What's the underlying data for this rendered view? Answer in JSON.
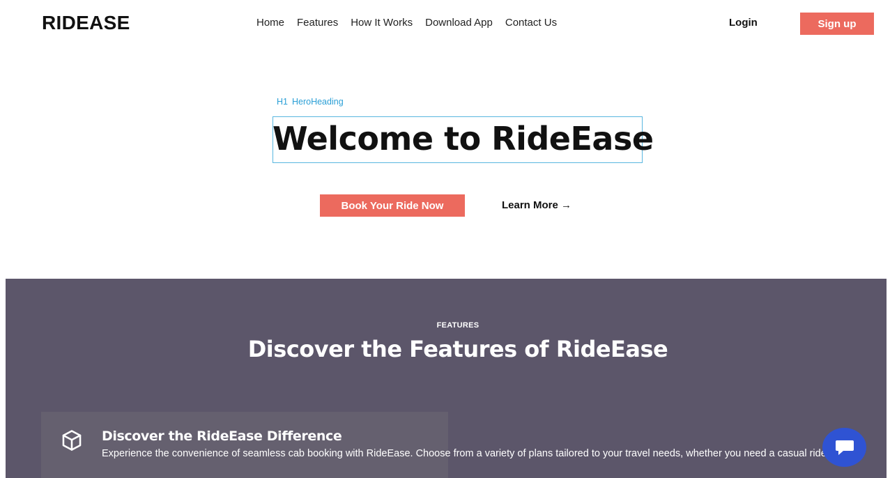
{
  "header": {
    "logo": "RIDEASE",
    "nav": [
      "Home",
      "Features",
      "How It Works",
      "Download App",
      "Contact Us"
    ],
    "login_label": "Login",
    "signup_label": "Sign up"
  },
  "hero": {
    "tag_type": "H1",
    "tag_name": "HeroHeading",
    "title": "Welcome to RideEase",
    "book_label": "Book Your Ride Now",
    "learn_label": "Learn More →"
  },
  "features": {
    "eyebrow": "FEATURES",
    "title": "Discover the Features of RideEase",
    "card": {
      "icon": "cube-icon",
      "title": "Discover the RideEase Difference",
      "text": "Experience the convenience of seamless cab booking with RideEase. Choose from a variety of plans tailored to your travel needs, whether you need a casual ride"
    }
  },
  "chat": {
    "icon": "chat-bubble-icon"
  },
  "colors": {
    "accent": "#ec6a5e",
    "features_bg": "#5c566a",
    "card_bg": "#65606f",
    "chat_bg": "#2f53d3",
    "selection": "#58b6e0"
  }
}
